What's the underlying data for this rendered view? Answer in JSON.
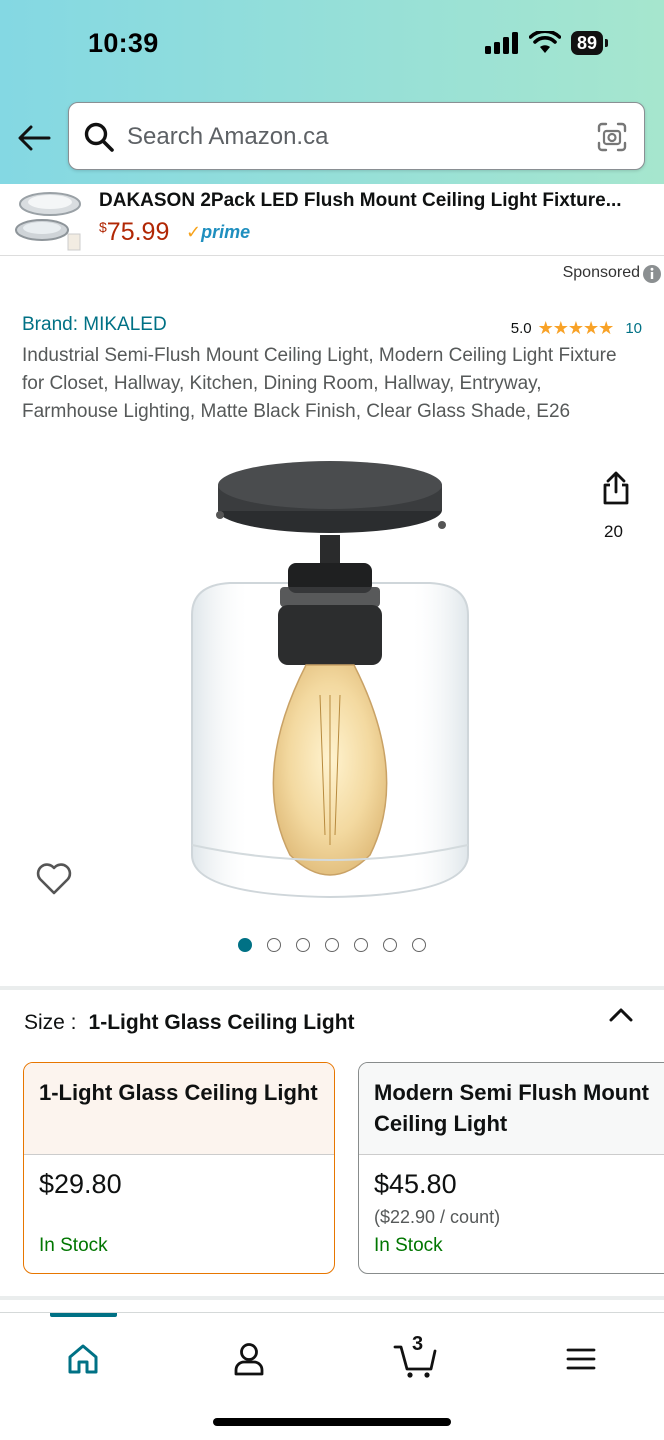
{
  "status_bar": {
    "time": "10:39",
    "battery": "89"
  },
  "search": {
    "placeholder": "Search Amazon.ca"
  },
  "sponsored_banner": {
    "title": "DAKASON 2Pack LED Flush Mount Ceiling Light Fixture...",
    "currency": "$",
    "price": "75.99",
    "prime_label": "prime"
  },
  "sponsored_label": "Sponsored",
  "product": {
    "brand": "Brand: MIKALED",
    "rating": "5.0",
    "rating_count": "10",
    "title": "Industrial Semi-Flush Mount Ceiling Light, Modern Ceiling Light Fixture for Closet, Hallway, Kitchen, Dining Room, Hallway, Entryway, Farmhouse Lighting, Matte Black Finish, Clear Glass Shade, E26",
    "share_count": "20",
    "image_count": 7,
    "active_image_index": 0
  },
  "size": {
    "label": "Size :",
    "selected": "1-Light Glass Ceiling Light",
    "options": [
      {
        "name": "1-Light Glass Ceiling Light",
        "price": "$29.80",
        "unit_price": "",
        "stock": "In Stock"
      },
      {
        "name": "Modern Semi Flush Mount Ceiling Light",
        "price": "$45.80",
        "unit_price": "($22.90 / count)",
        "stock": "In Stock"
      }
    ]
  },
  "bottom_nav": {
    "cart_count": "3",
    "items": [
      "home-icon",
      "account-icon",
      "cart-icon",
      "menu-icon"
    ]
  },
  "colors": {
    "accent": "#007185",
    "price": "#b12704",
    "stock": "#007600",
    "selected_border": "#e77600"
  }
}
